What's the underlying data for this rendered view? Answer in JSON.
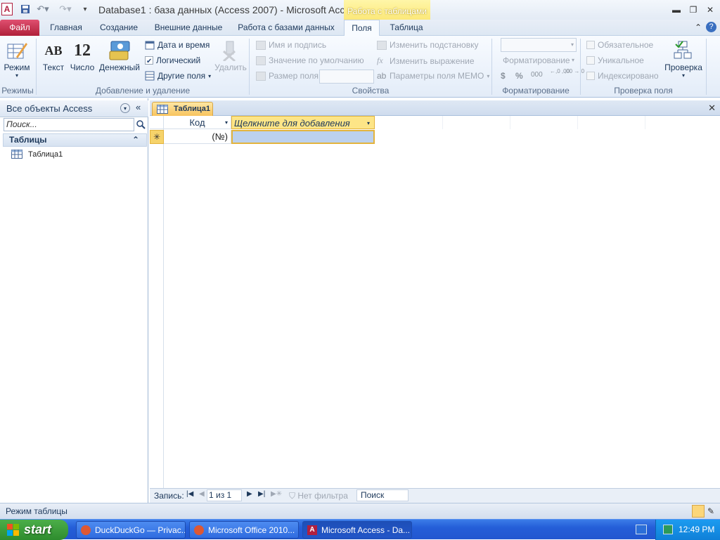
{
  "window": {
    "title": "Database1 : база данных (Access 2007)  -  Microsoft Acc...",
    "context_tab": "Работа с таблицами"
  },
  "tabs": [
    "Файл",
    "Главная",
    "Создание",
    "Внешние данные",
    "Работа с базами данных",
    "Поля",
    "Таблица"
  ],
  "ribbon": {
    "views": {
      "mode_label": "Режим",
      "group_label": "Режимы"
    },
    "add_delete": {
      "text_label": "Текст",
      "number_label": "Число",
      "currency_label": "Денежный",
      "datetime_label": "Дата и время",
      "boolean_label": "Логический",
      "other_fields_label": "Другие поля",
      "delete_label": "Удалить",
      "group_label": "Добавление и удаление",
      "text_icon": "AB",
      "number_icon": "12"
    },
    "properties": {
      "name_caption": "Имя и подпись",
      "default_value": "Значение по умолчанию",
      "field_size": "Размер поля",
      "modify_lookups": "Изменить подстановку",
      "modify_expression": "Изменить выражение",
      "memo_settings": "Параметры поля МЕМО",
      "group_label": "Свойства"
    },
    "formatting": {
      "format_combo": "Форматирование",
      "currency_symbol": "$",
      "percent_symbol": "%",
      "thousands_symbol": "000",
      "inc_decimals": "←,0 ,00",
      "dec_decimals": ",00 →,0",
      "group_label": "Форматирование"
    },
    "validation": {
      "required": "Обязательное",
      "unique": "Уникальное",
      "indexed": "Индексировано",
      "validation_btn": "Проверка",
      "group_label": "Проверка поля"
    }
  },
  "nav_pane": {
    "header": "Все объекты Access",
    "search_placeholder": "Поиск...",
    "group": "Таблицы",
    "items": [
      {
        "label": "Таблица1"
      }
    ]
  },
  "document": {
    "tab_label": "Таблица1",
    "columns": [
      "Код",
      "Щелкните для добавления"
    ],
    "new_row_marker": "✳",
    "new_row_value": "(№)"
  },
  "record_nav": {
    "label": "Запись:",
    "position": "1 из 1",
    "filter": "Нет фильтра",
    "search": "Поиск"
  },
  "status_bar": {
    "text": "Режим таблицы"
  },
  "taskbar": {
    "start": "start",
    "tasks": [
      {
        "label": "DuckDuckGo — Privac..."
      },
      {
        "label": "Microsoft Office 2010..."
      },
      {
        "label": "Microsoft Access - Da..."
      }
    ],
    "clock": "12:49 PM"
  },
  "colors": {
    "file_tab": "#c0304a",
    "context_tab": "#f5d84a",
    "taskbar": "#245ed8",
    "start": "#3a9a3a"
  }
}
